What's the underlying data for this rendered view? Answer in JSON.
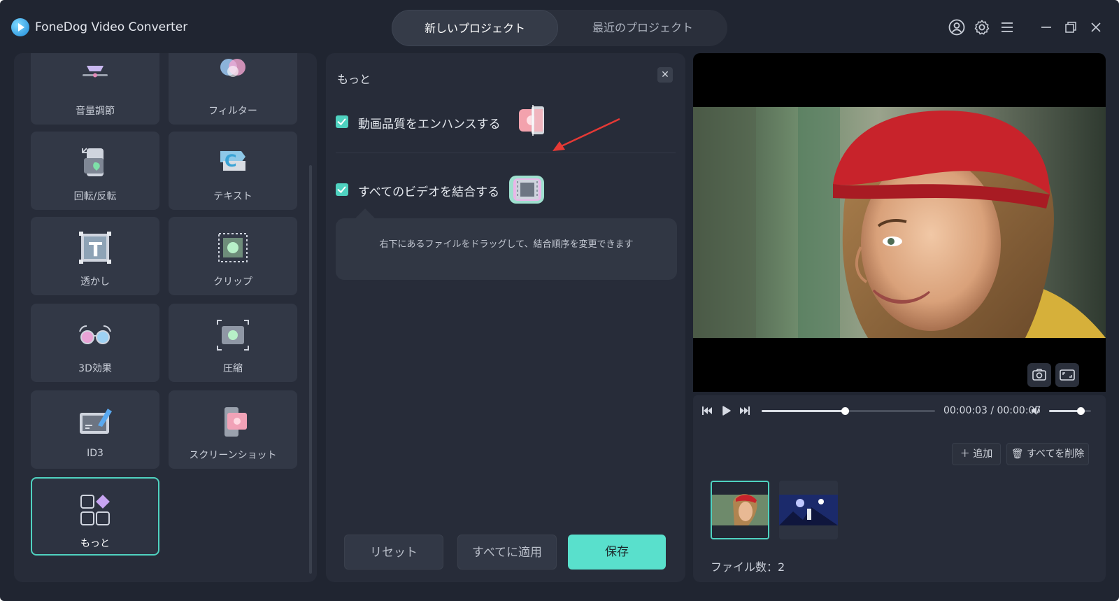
{
  "app": {
    "title": "FoneDog Video Converter"
  },
  "tabs": [
    {
      "label": "新しいプロジェクト",
      "active": true
    },
    {
      "label": "最近のプロジェクト",
      "active": false
    }
  ],
  "tools": [
    {
      "label": "音量調節",
      "icon": "volume-icon"
    },
    {
      "label": "フィルター",
      "icon": "filter-icon"
    },
    {
      "label": "回転/反転",
      "icon": "rotate-icon"
    },
    {
      "label": "テキスト",
      "icon": "text-icon"
    },
    {
      "label": "透かし",
      "icon": "watermark-icon"
    },
    {
      "label": "クリップ",
      "icon": "clip-icon"
    },
    {
      "label": "3D効果",
      "icon": "3d-glasses-icon"
    },
    {
      "label": "圧縮",
      "icon": "compress-icon"
    },
    {
      "label": "ID3",
      "icon": "id3-icon"
    },
    {
      "label": "スクリーンショット",
      "icon": "screenshot-icon"
    },
    {
      "label": "もっと",
      "icon": "more-icon",
      "selected": true
    }
  ],
  "more_panel": {
    "title": "もっと",
    "options": [
      {
        "label": "動画品質をエンハンスする",
        "checked": true
      },
      {
        "label": "すべてのビデオを結合する",
        "checked": true
      }
    ],
    "tooltip": "右下にあるファイルをドラッグして、結合順序を変更できます",
    "buttons": {
      "reset": "リセット",
      "apply_all": "すべてに適用",
      "save": "保存"
    }
  },
  "player": {
    "current_time": "00:00:03",
    "total_time": "00:00:07",
    "time_display": "00:00:03 / 00:00:07",
    "progress": 0.48,
    "volume": 0.75
  },
  "file_list": {
    "add_label": "追加",
    "delete_all_label": "すべてを削除",
    "count_label": "ファイル数：2"
  },
  "colors": {
    "accent": "#4fd2c0",
    "save_button": "#59e0cc",
    "background": "#202531",
    "panel": "#272c39"
  }
}
